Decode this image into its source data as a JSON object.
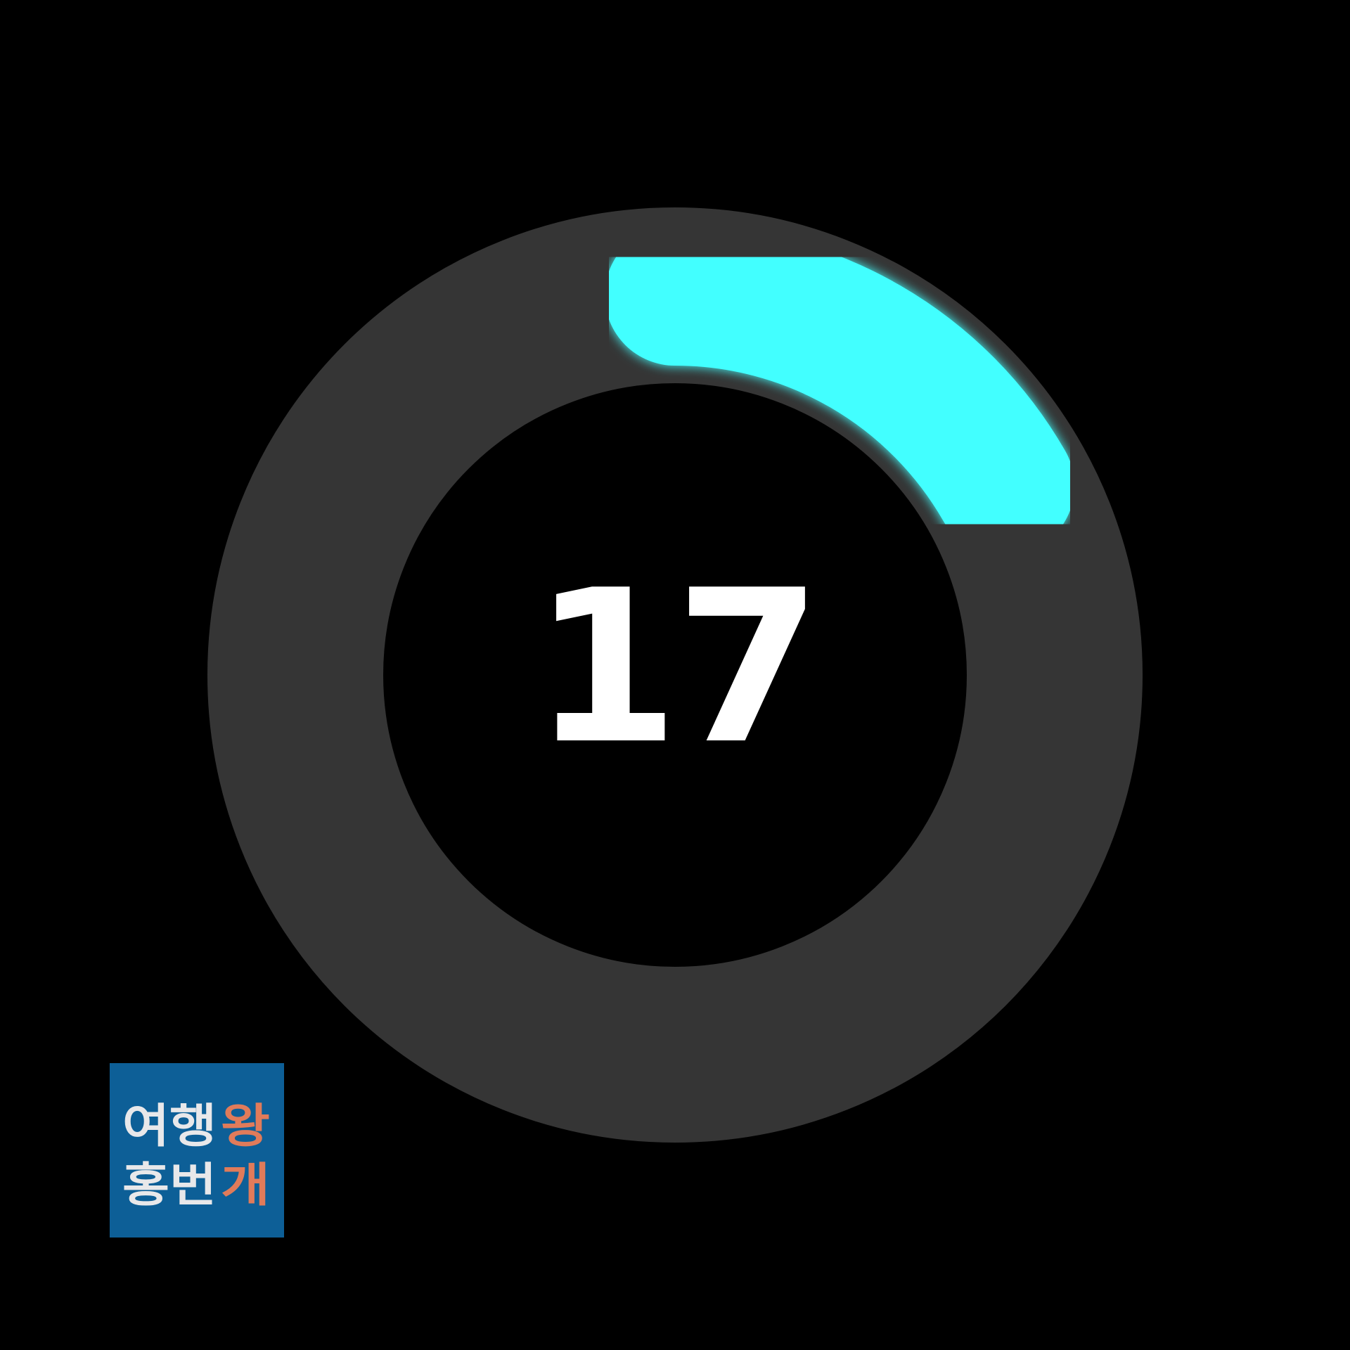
{
  "timer": {
    "value": "17",
    "progress_fraction": 0.167,
    "colors": {
      "background": "#000000",
      "track": "#353535",
      "progress": "#42ffff",
      "value_text": "#ffffff"
    }
  },
  "logo": {
    "text_line1": "여행왕",
    "text_line2": "홍번개",
    "colors": {
      "background": "#0d5f97",
      "text": "#e8e8ea",
      "accent": "#e07b5a"
    }
  }
}
